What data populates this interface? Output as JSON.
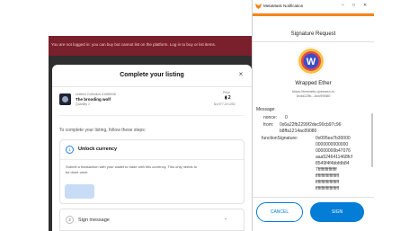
{
  "marketplace": {
    "banner_text": "You are not logged in: you can buy but cannot list on the platform. Log in to buy or list items."
  },
  "listing_modal": {
    "title": "Complete your listing",
    "close_icon": "×",
    "item": {
      "collection": "Untitled Collection #1686938",
      "name": "The brooding wolf",
      "quantity": "Quantity 1"
    },
    "price": {
      "label": "Price",
      "value": "⧫ 2",
      "usd": "$4,977.24 USD"
    },
    "instructions": "To complete your listing, follow these steps:",
    "steps": [
      {
        "number": "1",
        "title": "Unlock currency",
        "description": "Submit a transaction with your wallet to trade with this currency. This only needs to be done once."
      },
      {
        "number": "2",
        "title": "Sign message",
        "chevron": "⌄"
      }
    ]
  },
  "metamask": {
    "window_title": "MetaMask Notification",
    "header": "Signature Request",
    "token_name": "Wrapped Ether",
    "site": "https://testnets.opensea.io",
    "address": "0x4d22fb...Acc99080",
    "message_label": "Message:",
    "fields": [
      {
        "key": "nonce:",
        "value": "0"
      },
      {
        "key": "from:",
        "value": "0x6a22fb2299f2dec90cb97c96"
      },
      {
        "key": "",
        "value": "b8ffa1214ac89080"
      },
      {
        "key": "functionSignature:",
        "value": "0x095ea7b30000"
      },
      {
        "key": "",
        "value": "0000000000000"
      },
      {
        "key": "",
        "value": "00000000b47076"
      },
      {
        "key": "",
        "value": "aaa5246411468fcf"
      },
      {
        "key": "",
        "value": "8549f4f4bbfdb84"
      },
      {
        "key": "",
        "value": "7ffffffffffffffff"
      },
      {
        "key": "",
        "value": "ffffffffffffffffffff"
      },
      {
        "key": "",
        "value": "ffffffffffffffffffff"
      },
      {
        "key": "",
        "value": "ffffffffffffffffffff"
      }
    ],
    "cancel_label": "CANCEL",
    "sign_label": "SIGN",
    "colors": {
      "accent": "#037dd6",
      "orange": "#f6851b"
    }
  }
}
